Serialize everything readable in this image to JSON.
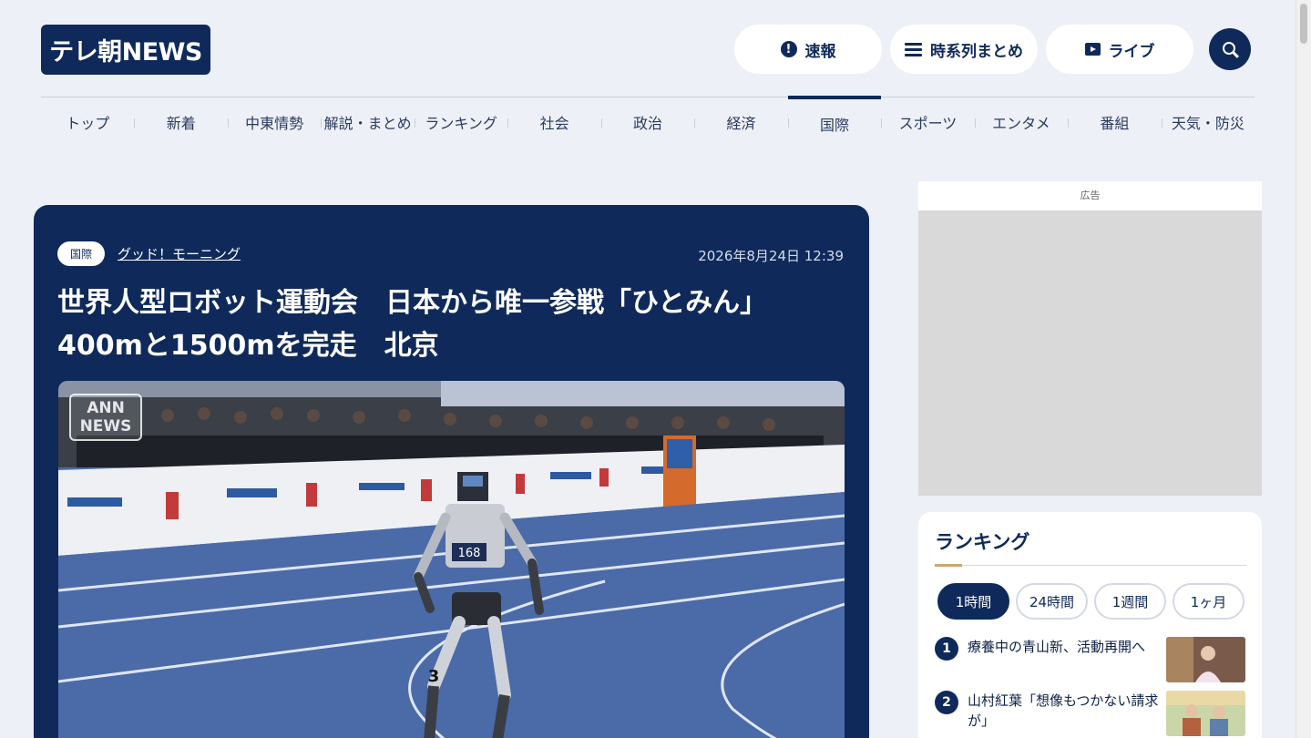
{
  "header": {
    "logo": "テレ朝NEWS",
    "buttons": {
      "alert": "速報",
      "timeline": "時系列まとめ",
      "live": "ライブ"
    }
  },
  "nav": [
    "トップ",
    "新着",
    "中東情勢",
    "解説・まとめ",
    "ランキング",
    "社会",
    "政治",
    "経済",
    "国際",
    "スポーツ",
    "エンタメ",
    "番組",
    "天気・防災"
  ],
  "nav_active": "国際",
  "article": {
    "tag": "国際",
    "program": "グッド！モーニング",
    "date": "2026年8月24日 12:39",
    "title_line1": "世界人型ロボット運動会　日本から唯一参戦「ひとみん」",
    "title_line2": "400mと1500mを完走　北京",
    "photo_logo_top": "ANN",
    "photo_logo_bottom": "NEWS",
    "bib_number": "168",
    "leg_number": "3"
  },
  "sidebar": {
    "ad_label": "広告",
    "ranking": {
      "title": "ランキング",
      "tabs": [
        "1時間",
        "24時間",
        "1週間",
        "1ヶ月"
      ],
      "active_tab": "1時間",
      "items": [
        {
          "rank": "1",
          "text": "療養中の青山新、活動再開へ"
        },
        {
          "rank": "2",
          "text": "山村紅葉「想像もつかない請求が」"
        }
      ]
    }
  },
  "colors": {
    "brand": "#0f2a5a",
    "background": "#edf0f6",
    "track": "#4b6aa8"
  }
}
